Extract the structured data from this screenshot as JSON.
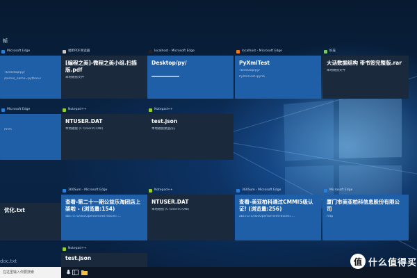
{
  "timeline": {
    "section_label": "帧"
  },
  "cards": [
    {
      "id": "c1",
      "header": "Microsoft Edge",
      "title": "",
      "sub": "/kernel_name=python3",
      "sub2": "'/Desktop/py/",
      "style": "blue",
      "icon_color": "#2b7fd8"
    },
    {
      "id": "c2",
      "header": "福昕PDF阅读器",
      "title": "[编程之美]-微程之美小组.扫描版.pdf",
      "sub": "本地磁盘文件",
      "style": "dark",
      "icon_color": "#c9c9c9"
    },
    {
      "id": "c3",
      "header": "localhost - Microsoft Edge",
      "title": "Desktop/py/",
      "sub": "",
      "style": "blue",
      "icon_color": "#222222"
    },
    {
      "id": "c4",
      "header": "localhost - Microsoft Edge",
      "title": "PyXmlTest",
      "sub": "PyXmlTest.ipynb",
      "sub2": "'/Desktop/py/",
      "style": "blue",
      "icon_color": "#f07a1a"
    },
    {
      "id": "c5",
      "header": "好压",
      "title": "大话数据结构 带书签完整版.rar",
      "sub": "本地磁盘文件",
      "style": "dark",
      "icon_color": "#7bc96f"
    },
    {
      "id": "c6",
      "header": "Microsoft Edge",
      "title": "",
      "sub": "/Vrm",
      "style": "blue",
      "icon_color": "#2b7fd8"
    },
    {
      "id": "c7",
      "header": "Notepad++",
      "title": "NTUSER.DAT",
      "sub": "本地磁盘 (C:\\Users\\TONI)",
      "style": "dark",
      "icon_color": "#9acd32"
    },
    {
      "id": "c8",
      "header": "Notepad++",
      "title": "test.json",
      "sub": "本地磁盘桌面/py",
      "style": "dark",
      "icon_color": "#9acd32"
    },
    {
      "id": "c9",
      "header": "",
      "title": "优化.txt",
      "sub": "",
      "style": "dark",
      "icon_color": "#9acd32"
    },
    {
      "id": "c10",
      "header": "360Sum - Microsoft Edge",
      "title": "查看-第二十一期公益乐淘团店上架啦 - (浏览量:154)",
      "sub": "abc7575/docOpenServlet?docId=...",
      "style": "blue",
      "icon_color": "#2b7fd8"
    },
    {
      "id": "c11",
      "header": "Notepad++",
      "title": "NTUSER.DAT",
      "sub": "本地磁盘 (C:\\Users\\TONI)",
      "style": "dark",
      "icon_color": "#9acd32"
    },
    {
      "id": "c12",
      "header": "360Sum - Microsoft Edge",
      "title": "查看-美亚柏科通过CMMI5级认证! (浏览量:256)",
      "sub": "abc7575/docOpenServlet?docId=...",
      "style": "blue",
      "icon_color": "#2b7fd8"
    },
    {
      "id": "c13",
      "header": "Microsoft Edge",
      "title": "厦门市美亚柏科信息股份有限公司",
      "sub": "http",
      "style": "blue",
      "icon_color": "#2b7fd8"
    },
    {
      "id": "c14",
      "header": "Notepad++",
      "title": "test.json",
      "sub": "",
      "style": "dark",
      "icon_color": "#9acd32"
    }
  ],
  "bottom_left_text": "doc.txt",
  "taskbar": {
    "search_placeholder": "在这里输入你要搜索"
  },
  "watermark": {
    "logo_char": "值",
    "text": "什么值得买"
  }
}
